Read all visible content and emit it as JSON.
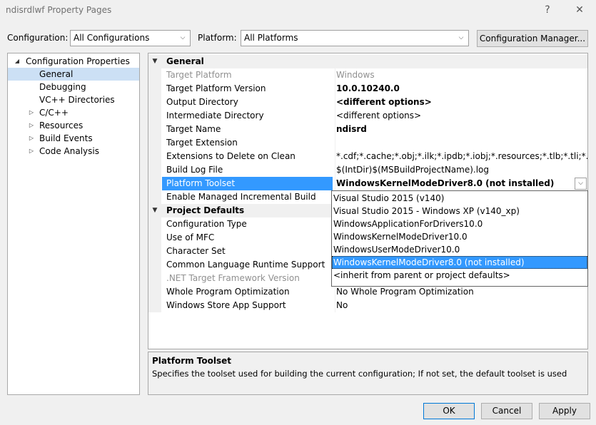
{
  "window": {
    "title": "ndisrdlwf Property Pages",
    "help_glyph": "?",
    "close_glyph": "✕"
  },
  "toolbar": {
    "configuration_label": "Configuration:",
    "configuration_value": "All Configurations",
    "platform_label": "Platform:",
    "platform_value": "All Platforms",
    "config_manager_label": "Configuration Manager..."
  },
  "tree": {
    "root": "Configuration Properties",
    "items": [
      "General",
      "Debugging",
      "VC++ Directories",
      "C/C++",
      "Resources",
      "Build Events",
      "Code Analysis"
    ],
    "selected": "General"
  },
  "grid": {
    "general": {
      "header": "General",
      "rows": [
        {
          "name": "Target Platform",
          "value": "Windows"
        },
        {
          "name": "Target Platform Version",
          "value": "10.0.10240.0"
        },
        {
          "name": "Output Directory",
          "value": "<different options>"
        },
        {
          "name": "Intermediate Directory",
          "value": "<different options>"
        },
        {
          "name": "Target Name",
          "value": "ndisrd"
        },
        {
          "name": "Target Extension",
          "value": ""
        },
        {
          "name": "Extensions to Delete on Clean",
          "value": "*.cdf;*.cache;*.obj;*.ilk;*.ipdb;*.iobj;*.resources;*.tlb;*.tli;*.tlh;*.tmp;*"
        },
        {
          "name": "Build Log File",
          "value": "$(IntDir)$(MSBuildProjectName).log"
        },
        {
          "name": "Platform Toolset",
          "value": "WindowsKernelModeDriver8.0 (not installed)"
        },
        {
          "name": "Enable Managed Incremental Build",
          "value": ""
        }
      ]
    },
    "project_defaults": {
      "header": "Project Defaults",
      "rows": [
        {
          "name": "Configuration Type",
          "value": ""
        },
        {
          "name": "Use of MFC",
          "value": ""
        },
        {
          "name": "Character Set",
          "value": ""
        },
        {
          "name": "Common Language Runtime Support",
          "value": ""
        },
        {
          "name": ".NET Target Framework Version",
          "value": ""
        },
        {
          "name": "Whole Program Optimization",
          "value": "No Whole Program Optimization"
        },
        {
          "name": "Windows Store App Support",
          "value": "No"
        }
      ]
    }
  },
  "dropdown": {
    "options": [
      "Visual Studio 2015 (v140)",
      "Visual Studio 2015 - Windows XP (v140_xp)",
      "WindowsApplicationForDrivers10.0",
      "WindowsKernelModeDriver10.0",
      "WindowsUserModeDriver10.0",
      "WindowsKernelModeDriver8.0 (not installed)",
      "<inherit from parent or project defaults>"
    ],
    "selected": "WindowsKernelModeDriver8.0 (not installed)"
  },
  "description": {
    "title": "Platform Toolset",
    "text": "Specifies the toolset used for building the current configuration; If not set, the default toolset is used"
  },
  "buttons": {
    "ok": "OK",
    "cancel": "Cancel",
    "apply": "Apply"
  }
}
